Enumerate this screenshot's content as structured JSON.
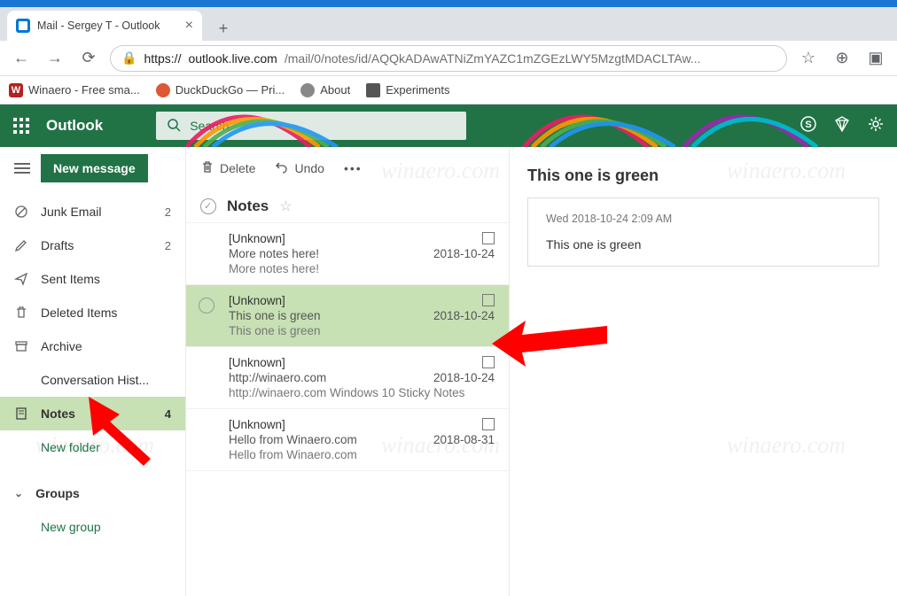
{
  "browser": {
    "tab_title": "Mail - Sergey T - Outlook",
    "url_scheme": "https://",
    "url_host": "outlook.live.com",
    "url_path": "/mail/0/notes/id/AQQkADAwATNiZmYAZC1mZGEzLWY5MzgtMDACLTAw...",
    "bookmarks": [
      {
        "label": "Winaero - Free sma..."
      },
      {
        "label": "DuckDuckGo — Pri..."
      },
      {
        "label": "About"
      },
      {
        "label": "Experiments"
      }
    ]
  },
  "header": {
    "brand": "Outlook",
    "search_placeholder": "Search"
  },
  "sidebar": {
    "new_message": "New message",
    "folders": [
      {
        "icon": "junk",
        "label": "Junk Email",
        "count": "2"
      },
      {
        "icon": "drafts",
        "label": "Drafts",
        "count": "2"
      },
      {
        "icon": "sent",
        "label": "Sent Items",
        "count": ""
      },
      {
        "icon": "deleted",
        "label": "Deleted Items",
        "count": ""
      },
      {
        "icon": "archive",
        "label": "Archive",
        "count": ""
      },
      {
        "icon": "",
        "label": "Conversation Hist...",
        "count": ""
      },
      {
        "icon": "notes",
        "label": "Notes",
        "count": "4",
        "selected": true
      }
    ],
    "new_folder": "New folder",
    "groups": "Groups",
    "new_group": "New group"
  },
  "toolbar": {
    "delete": "Delete",
    "undo": "Undo"
  },
  "list": {
    "title": "Notes",
    "items": [
      {
        "from": "[Unknown]",
        "subject": "More notes here!",
        "preview": "More notes here!",
        "date": "2018-10-24"
      },
      {
        "from": "[Unknown]",
        "subject": "This one is green",
        "preview": "This one is green",
        "date": "2018-10-24",
        "selected": true
      },
      {
        "from": "[Unknown]",
        "subject": "http://winaero.com",
        "preview": "http://winaero.com Windows 10 Sticky Notes",
        "date": "2018-10-24"
      },
      {
        "from": "[Unknown]",
        "subject": "Hello from Winaero.com",
        "preview": "Hello from Winaero.com",
        "date": "2018-08-31"
      }
    ]
  },
  "reading": {
    "title": "This one is green",
    "date": "Wed 2018-10-24 2:09 AM",
    "body": "This one is green"
  },
  "watermark": "winaero.com"
}
